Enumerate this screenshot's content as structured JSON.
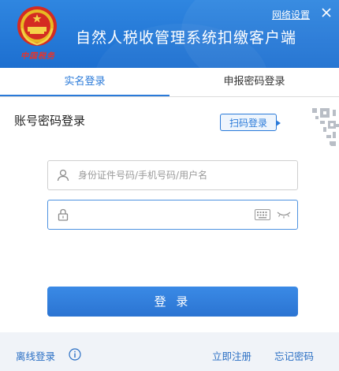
{
  "header": {
    "title": "自然人税收管理系统扣缴客户端",
    "logo_caption": "中国税务",
    "network_settings": "网络设置",
    "close_icon": "close-icon",
    "colors": {
      "header_blue": "#1d6fd0",
      "emblem_red": "#e8342a"
    }
  },
  "tabs": [
    {
      "label": "实名登录",
      "active": true
    },
    {
      "label": "申报密码登录",
      "active": false
    }
  ],
  "login": {
    "section_title": "账号密码登录",
    "scan_button": "扫码登录",
    "username": {
      "value": "",
      "placeholder": "身份证件号码/手机号码/用户名",
      "icon": "user-icon"
    },
    "password": {
      "value": "",
      "placeholder": "",
      "icon": "lock-icon"
    },
    "submit": "登 录",
    "accent": "#2a7ad9"
  },
  "footer": {
    "offline_login": "离线登录",
    "register": "立即注册",
    "forgot_password": "忘记密码"
  }
}
